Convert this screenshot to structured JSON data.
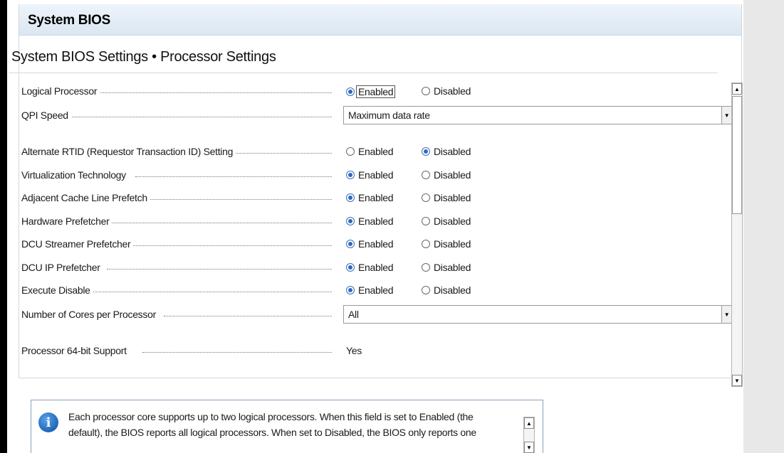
{
  "header": {
    "title": "System BIOS"
  },
  "page": {
    "subtitle": "System BIOS Settings • Processor Settings"
  },
  "settings": {
    "logical_processor": {
      "label": "Logical Processor",
      "opt1": "Enabled",
      "opt2": "Disabled",
      "selected": "Enabled"
    },
    "qpi_speed": {
      "label": "QPI Speed",
      "value": "Maximum data rate"
    },
    "alternate_rtid": {
      "label": "Alternate RTID (Requestor Transaction ID) Setting",
      "opt1": "Enabled",
      "opt2": "Disabled",
      "selected": "Disabled"
    },
    "virtualization": {
      "label": "Virtualization Technology",
      "opt1": "Enabled",
      "opt2": "Disabled",
      "selected": "Enabled"
    },
    "adjacent_cache": {
      "label": "Adjacent Cache Line Prefetch",
      "opt1": "Enabled",
      "opt2": "Disabled",
      "selected": "Enabled"
    },
    "hw_prefetcher": {
      "label": "Hardware Prefetcher",
      "opt1": "Enabled",
      "opt2": "Disabled",
      "selected": "Enabled"
    },
    "dcu_streamer": {
      "label": "DCU Streamer Prefetcher",
      "opt1": "Enabled",
      "opt2": "Disabled",
      "selected": "Enabled"
    },
    "dcu_ip": {
      "label": "DCU IP Prefetcher",
      "opt1": "Enabled",
      "opt2": "Disabled",
      "selected": "Enabled"
    },
    "execute_disable": {
      "label": "Execute Disable",
      "opt1": "Enabled",
      "opt2": "Disabled",
      "selected": "Enabled"
    },
    "cores_per_processor": {
      "label": "Number of Cores per Processor",
      "value": "All"
    },
    "processor_64bit": {
      "label": "Processor 64-bit Support",
      "value": "Yes"
    }
  },
  "help": {
    "text": "Each processor core supports up to two logical processors. When this field is set to Enabled (the default), the BIOS reports all logical processors.  When set to Disabled, the BIOS only reports one"
  },
  "icons": {
    "info": "info-icon",
    "scroll_up": "▲",
    "scroll_down": "▼",
    "dropdown": "▼"
  },
  "colors": {
    "header_gradient_top": "#eef4fa",
    "header_gradient_bottom": "#dbe7f3",
    "radio_selected": "#2f67c4",
    "info_icon": "#1f66b8"
  }
}
